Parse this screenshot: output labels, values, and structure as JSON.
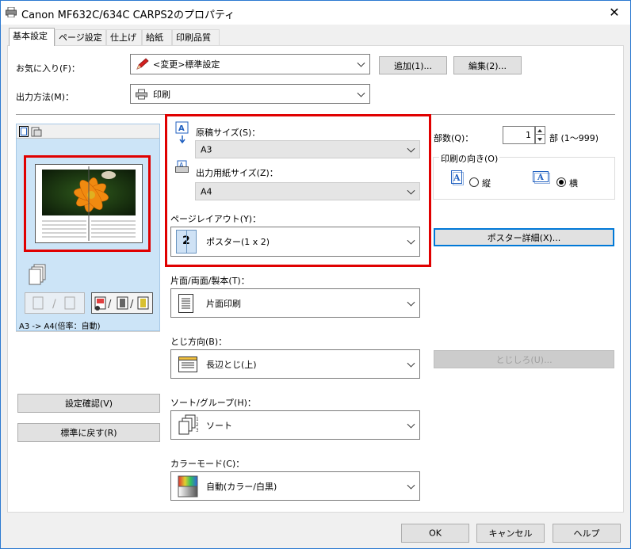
{
  "window": {
    "title": "Canon MF632C/634C CARPS2のプロパティ",
    "close_glyph": "✕"
  },
  "tabs": [
    {
      "label": "基本設定"
    },
    {
      "label": "ページ設定"
    },
    {
      "label": "仕上げ"
    },
    {
      "label": "給紙"
    },
    {
      "label": "印刷品質"
    }
  ],
  "favorites": {
    "label": "お気に入り(F)：",
    "value": "<変更>標準設定",
    "add_button": "追加(1)...",
    "edit_button": "編集(2)..."
  },
  "output_method": {
    "label": "出力方法(M)：",
    "value": "印刷"
  },
  "preview": {
    "status": "A3 -> A4(倍率：自動)",
    "settings_confirm_button": "設定確認(V)",
    "restore_defaults_button": "標準に戻す(R)"
  },
  "original_size": {
    "label": "原稿サイズ(S)：",
    "value": "A3"
  },
  "output_paper_size": {
    "label": "出力用紙サイズ(Z)：",
    "value": "A4"
  },
  "page_layout": {
    "label": "ページレイアウト(Y)：",
    "value": "ポスター(1 x 2)",
    "icon_number": "2"
  },
  "copies": {
    "label": "部数(Q)：",
    "value": "1",
    "suffix": "部 (1〜999)"
  },
  "orientation": {
    "label": "印刷の向き(O)",
    "portrait": "縦",
    "landscape": "横",
    "selected": "landscape"
  },
  "poster_details_button": "ポスター詳細(X)...",
  "duplex": {
    "label": "片面/両面/製本(T)：",
    "value": "片面印刷"
  },
  "binding": {
    "label": "とじ方向(B)：",
    "value": "長辺とじ(上)"
  },
  "binding_margin_button": "とじしろ(U)...",
  "sort": {
    "label": "ソート/グループ(H)：",
    "value": "ソート"
  },
  "color_mode": {
    "label": "カラーモード(C)：",
    "value": "自動(カラー/白黒)"
  },
  "footer": {
    "ok": "OK",
    "cancel": "キャンセル",
    "help": "ヘルプ"
  },
  "colors": {
    "highlight_red": "#e00000",
    "accent_blue": "#0078d7",
    "preview_bg": "#cce4f7"
  }
}
